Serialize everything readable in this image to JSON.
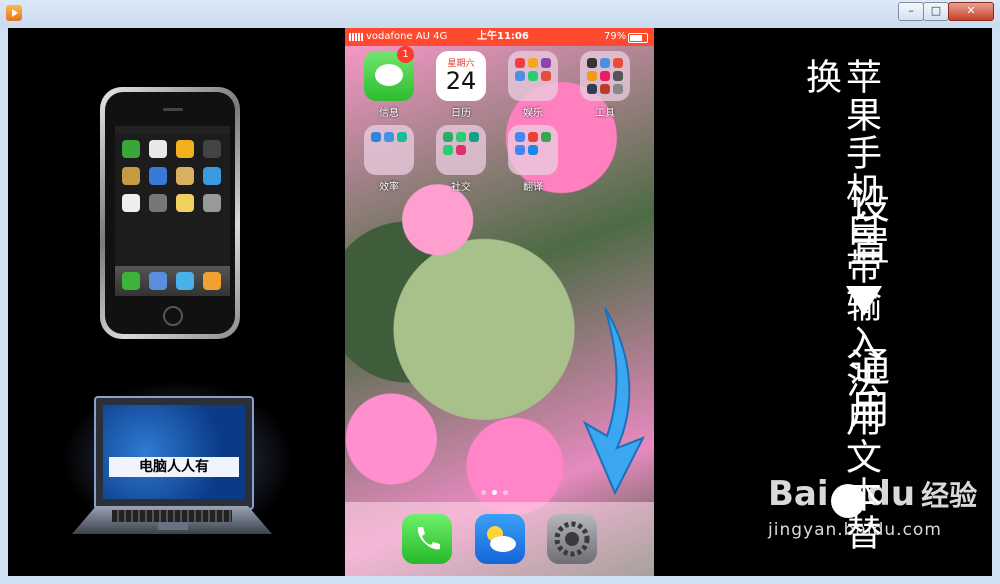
{
  "window": {
    "title": "",
    "controls": {
      "minimize": "–",
      "maximize": "□",
      "close": "✕"
    }
  },
  "phone": {
    "status": {
      "carrier": "vodafone AU   4G",
      "time": "上午11:06",
      "battery": "79%"
    },
    "apps": [
      {
        "label": "信息",
        "icon": "messages-icon",
        "badge": "1"
      },
      {
        "label": "日历",
        "icon": "calendar-icon",
        "weekday": "星期六",
        "day": "24"
      },
      {
        "label": "娱乐",
        "icon": "folder-icon"
      },
      {
        "label": "工具",
        "icon": "folder-icon"
      },
      {
        "label": "效率",
        "icon": "folder-icon"
      },
      {
        "label": "社交",
        "icon": "folder-icon"
      },
      {
        "label": "翻译",
        "icon": "folder-icon"
      }
    ],
    "dock": [
      {
        "icon": "phone-icon"
      },
      {
        "icon": "weather-icon"
      },
      {
        "icon": "settings-icon"
      }
    ],
    "page_dots": 3,
    "active_dot": 1
  },
  "overlay": {
    "main_title": "苹果手机自带输入法用文本替换",
    "sub1": "设置",
    "arrow": "▼",
    "sub2": "通用"
  },
  "laptop": {
    "label": "电脑人人有"
  },
  "watermark": {
    "logo_left": "Bai",
    "logo_right": "du",
    "experience": "经验",
    "url": "jingyan.baidu.com"
  },
  "colors": {
    "status_bar": "#ff4a2f",
    "badge": "#ff3b30",
    "arrow": "#3aa7f0"
  }
}
